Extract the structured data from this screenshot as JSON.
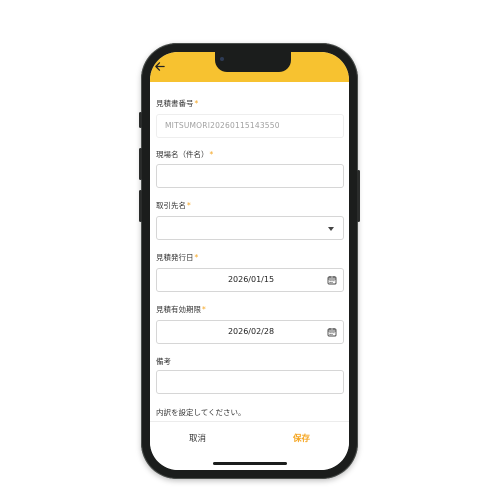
{
  "form": {
    "estimate_number": {
      "label": "見積書番号",
      "required_mark": "*",
      "value": "MITSUMORI20260115143550"
    },
    "site_name": {
      "label": "現場名（件名）",
      "required_mark": "*",
      "value": ""
    },
    "client": {
      "label": "取引先名",
      "required_mark": "*",
      "value": ""
    },
    "issue_date": {
      "label": "見積発行日",
      "required_mark": "*",
      "value": "2026/01/15"
    },
    "expiry_date": {
      "label": "見積有効期限",
      "required_mark": "*",
      "value": "2026/02/28"
    },
    "remarks": {
      "label": "備考",
      "value": ""
    },
    "note": "内訳を設定してください。"
  },
  "actions": {
    "cancel_label": "取消",
    "save_label": "保存"
  },
  "colors": {
    "appbar": "#f7c230",
    "accent": "#f5a623",
    "phone_frame": "#1b1d1c"
  },
  "icons": {
    "back": "arrow-left-icon",
    "calendar": "calendar-icon",
    "dropdown": "chevron-down-icon"
  }
}
